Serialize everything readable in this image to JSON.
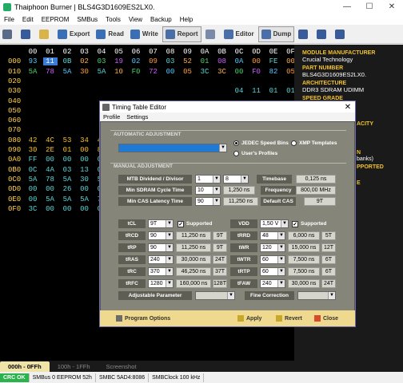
{
  "window": {
    "title": "Thaiphoon Burner | BLS4G3D1609ES2LX0.",
    "min": "—",
    "max": "☐",
    "close": "✕"
  },
  "menu": [
    "File",
    "Edit",
    "EEPROM",
    "SMBus",
    "Tools",
    "View",
    "Backup",
    "Help"
  ],
  "toolbar": {
    "export": "Export",
    "read": "Read",
    "write": "Write",
    "report": "Report",
    "editor": "Editor",
    "dump": "Dump"
  },
  "hex": {
    "header": [
      "00",
      "01",
      "02",
      "03",
      "04",
      "05",
      "06",
      "07",
      "08",
      "09",
      "0A",
      "0B",
      "0C",
      "0D",
      "0E",
      "0F"
    ],
    "rows": [
      {
        "addr": "000",
        "cells": [
          "93",
          "11",
          "0B",
          "02",
          "03",
          "19",
          "02",
          "09",
          "03",
          "52",
          "01",
          "08",
          "0A",
          "00",
          "FE",
          "00"
        ]
      },
      {
        "addr": "010",
        "cells": [
          "5A",
          "78",
          "5A",
          "30",
          "5A",
          "10",
          "F0",
          "72",
          "00",
          "05",
          "3C",
          "3C",
          "00",
          "F0",
          "82",
          "05"
        ]
      },
      {
        "addr": "020",
        "cells": [
          "",
          "",
          "",
          "",
          "",
          "",
          "",
          "",
          "",
          "",
          "",
          "",
          "",
          "",
          "",
          ""
        ]
      },
      {
        "addr": "030",
        "cells": [
          "",
          "",
          "",
          "",
          "",
          "",
          "",
          "",
          "",
          "",
          "",
          "",
          "04",
          "11",
          "01",
          "01"
        ]
      },
      {
        "addr": "040",
        "cells": [
          "",
          "",
          "",
          "",
          "",
          "",
          "",
          "",
          "",
          "",
          "",
          "",
          "",
          "",
          "",
          ""
        ]
      },
      {
        "addr": "050",
        "cells": [
          "",
          "",
          "",
          "",
          "",
          "",
          "",
          "",
          "",
          "",
          "",
          "",
          "",
          "",
          "",
          ""
        ]
      },
      {
        "addr": "060",
        "cells": [
          "",
          "",
          "",
          "",
          "",
          "",
          "",
          "",
          "",
          "",
          "",
          "",
          "",
          "",
          "",
          ""
        ]
      },
      {
        "addr": "070",
        "cells": [
          "",
          "",
          "",
          "",
          "",
          "",
          "",
          "",
          "",
          "",
          "",
          "",
          "",
          "",
          "",
          ""
        ]
      },
      {
        "addr": "080",
        "cells": [
          "42",
          "4C",
          "53",
          "34",
          "47",
          "",
          "",
          "",
          "",
          "",
          "",
          "",
          "",
          "",
          "",
          ""
        ]
      },
      {
        "addr": "090",
        "cells": [
          "30",
          "2E",
          "01",
          "00",
          "80",
          "",
          "",
          "",
          "",
          "",
          "",
          "",
          "",
          "",
          "",
          ""
        ]
      },
      {
        "addr": "0A0",
        "cells": [
          "FF",
          "00",
          "00",
          "00",
          "00",
          "",
          "",
          "",
          "",
          "",
          "",
          "",
          "",
          "",
          "",
          ""
        ]
      },
      {
        "addr": "0B0",
        "cells": [
          "0C",
          "4A",
          "03",
          "13",
          "00",
          "",
          "",
          "",
          "",
          "",
          "",
          "",
          "",
          "",
          "",
          ""
        ]
      },
      {
        "addr": "0C0",
        "cells": [
          "5A",
          "78",
          "5A",
          "30",
          "5A",
          "",
          "",
          "",
          "",
          "",
          "",
          "",
          "",
          "",
          "",
          ""
        ]
      },
      {
        "addr": "0D0",
        "cells": [
          "00",
          "00",
          "26",
          "00",
          "00",
          "",
          "",
          "",
          "",
          "",
          "",
          "",
          "",
          "",
          "",
          ""
        ]
      },
      {
        "addr": "0E0",
        "cells": [
          "00",
          "5A",
          "5A",
          "5A",
          "78",
          "",
          "",
          "",
          "",
          "",
          "",
          "",
          "",
          "",
          "",
          ""
        ]
      },
      {
        "addr": "0F0",
        "cells": [
          "3C",
          "00",
          "00",
          "00",
          "00",
          "",
          "",
          "",
          "",
          "",
          "",
          "",
          "",
          "",
          "",
          ""
        ]
      }
    ]
  },
  "info": [
    {
      "label": "MODULE MANUFACTURER",
      "value": "Crucial Technology"
    },
    {
      "label": "PART NUMBER",
      "value": "BLS4G3D1609ES2LX0."
    },
    {
      "label": "ARCHITECTURE",
      "value": "DDR3 SDRAM UDIMM"
    },
    {
      "label": "SPEED GRADE",
      "value": ""
    }
  ],
  "info_peek": [
    "ACITY",
    "N",
    "PPORTED",
    "banks)",
    "E"
  ],
  "tabs": [
    "000h - 0FFh",
    "100h - 1FFh",
    "Screenshot"
  ],
  "status": {
    "crc": "CRC OK",
    "smbus": "SMBus 0 EEPROM 52h",
    "smbc": "SMBC 5AD4:8086",
    "clock": "SMBClock 100 kHz"
  },
  "dialog": {
    "title": "Timing Table Editor",
    "close": "✕",
    "menu": [
      "Profile",
      "Settings"
    ],
    "auto_heading": "AUTOMATIC ADJUSTMENT",
    "manual_heading": "MANUAL ADJUSTMENT",
    "radio_jedec": "JEDEC Speed Bins",
    "radio_xmp": "XMP Templates",
    "radio_user": "User's Profiles",
    "mtb_label": "MTB Dividend / Divisor",
    "mtb_dividend": "1",
    "mtb_divisor": "8",
    "timebase_label": "Timebase",
    "timebase_value": "0,125 ns",
    "min_sdram_label": "Min SDRAM Cycle Time",
    "min_sdram_value": "10",
    "min_sdram_ns": "1,250 ns",
    "frequency_label": "Frequency",
    "frequency_value": "800,00 MHz",
    "min_cas_label": "Min CAS Latency Time",
    "min_cas_value": "90",
    "min_cas_ns": "11,250 ns",
    "default_cas_label": "Default CAS",
    "default_cas_value": "9T",
    "tcl_label": "tCL",
    "tcl_value": "9T",
    "supported": "Supported",
    "vdd_label": "VDD",
    "vdd_value": "1,50 V",
    "left_timings": [
      {
        "label": "tRCD",
        "v": "90",
        "ns": "11,250 ns",
        "t": "9T"
      },
      {
        "label": "tRP",
        "v": "90",
        "ns": "11,250 ns",
        "t": "9T"
      },
      {
        "label": "tRAS",
        "v": "240",
        "ns": "30,000 ns",
        "t": "24T"
      },
      {
        "label": "tRC",
        "v": "370",
        "ns": "46,250 ns",
        "t": "37T"
      },
      {
        "label": "tRFC",
        "v": "1280",
        "ns": "160,000 ns",
        "t": "128T"
      }
    ],
    "right_timings": [
      {
        "label": "tRRD",
        "v": "48",
        "ns": "6,000 ns",
        "t": "5T"
      },
      {
        "label": "tWR",
        "v": "120",
        "ns": "15,000 ns",
        "t": "12T"
      },
      {
        "label": "tWTR",
        "v": "60",
        "ns": "7,500 ns",
        "t": "6T"
      },
      {
        "label": "tRTP",
        "v": "60",
        "ns": "7,500 ns",
        "t": "6T"
      },
      {
        "label": "tFAW",
        "v": "240",
        "ns": "30,000 ns",
        "t": "24T"
      }
    ],
    "adj_param_label": "Adjustable Parameter",
    "fine_corr_label": "Fine Correction",
    "btn_program": "Program Options",
    "btn_apply": "Apply",
    "btn_revert": "Revert",
    "btn_close": "Close"
  },
  "colors": {
    "hex_bg": "#000000",
    "accent": "#f3c12c",
    "dialog_bg": "#86857a",
    "dialog_foot": "#efd98e"
  }
}
